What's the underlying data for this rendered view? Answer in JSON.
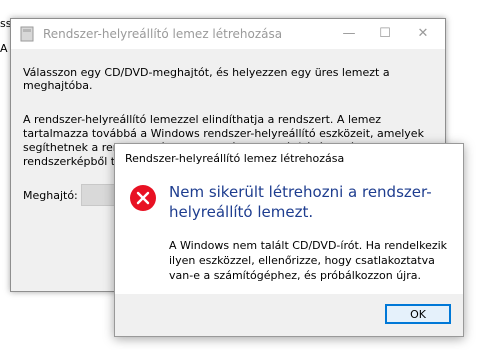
{
  "background_partial": {
    "top_label": "ssz",
    "left_label": "A"
  },
  "wizard": {
    "title": "Rendszer-helyreállító lemez létrehozása",
    "instruction": "Válasszon egy CD/DVD-meghajtót, és helyezzen egy üres lemezt a meghajtóba.",
    "description": "A rendszer-helyreállító lemezzel elindíthatja a rendszert. A lemez tartalmazza továbbá a Windows rendszer-helyreállító eszközeit, amelyek segíthetnek a rendszer súlyos hiba utáni helyreállításában és rendszerképből történő visszaállításában.",
    "drive_label": "Meghajtó:",
    "drive_value": "",
    "controls": {
      "minimize": "—",
      "maximize": "☐",
      "close": "✕"
    }
  },
  "error_dialog": {
    "title": "Rendszer-helyreállító lemez létrehozása",
    "main_instruction": "Nem sikerült létrehozni a rendszer-helyreállító lemezt.",
    "content": "A Windows nem talált CD/DVD-írót. Ha rendelkezik ilyen eszközzel, ellenőrizze, hogy csatlakoztatva van-e a számítógéphez, és próbálkozzon újra.",
    "ok_label": "OK",
    "icon": "error-icon",
    "icon_color": "#e81123"
  }
}
